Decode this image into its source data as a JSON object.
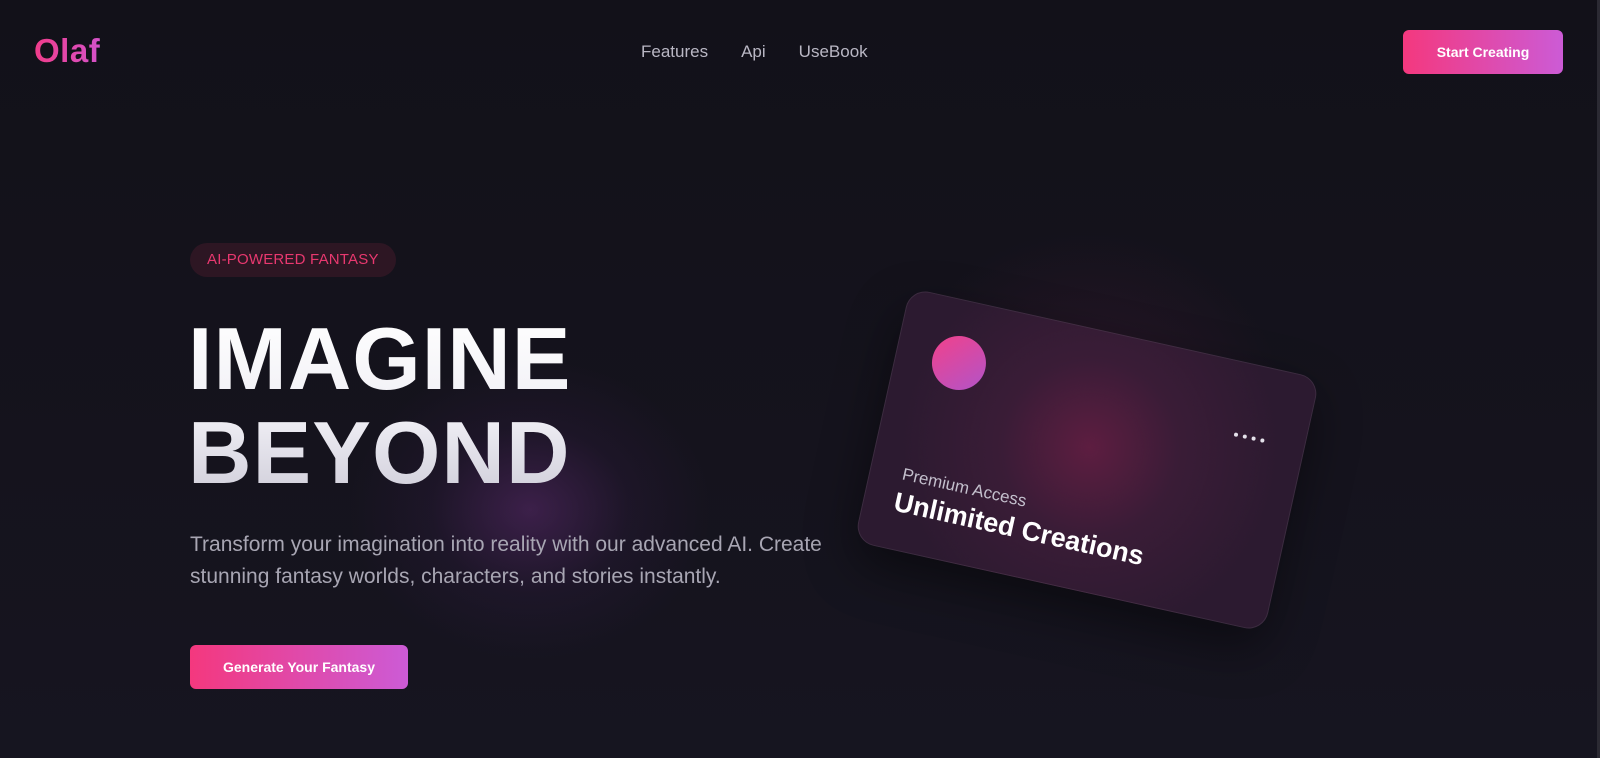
{
  "header": {
    "logo": "Olaf",
    "nav": [
      "Features",
      "Api",
      "UseBook"
    ],
    "cta": "Start Creating"
  },
  "hero": {
    "badge": "AI-POWERED FANTASY",
    "headline": [
      "IMAGINE",
      "BEYOND"
    ],
    "description": "Transform your imagination into reality with our advanced AI. Create stunning fantasy worlds, characters, and stories instantly.",
    "cta": "Generate Your Fantasy"
  },
  "card": {
    "subtitle": "Premium Access",
    "title": "Unlimited Creations",
    "menu_icon": "more-dots-icon"
  },
  "colors": {
    "background": "#13121a",
    "accent_start": "#f4387e",
    "accent_end": "#cc5bd6",
    "badge_text": "#e8386f"
  }
}
